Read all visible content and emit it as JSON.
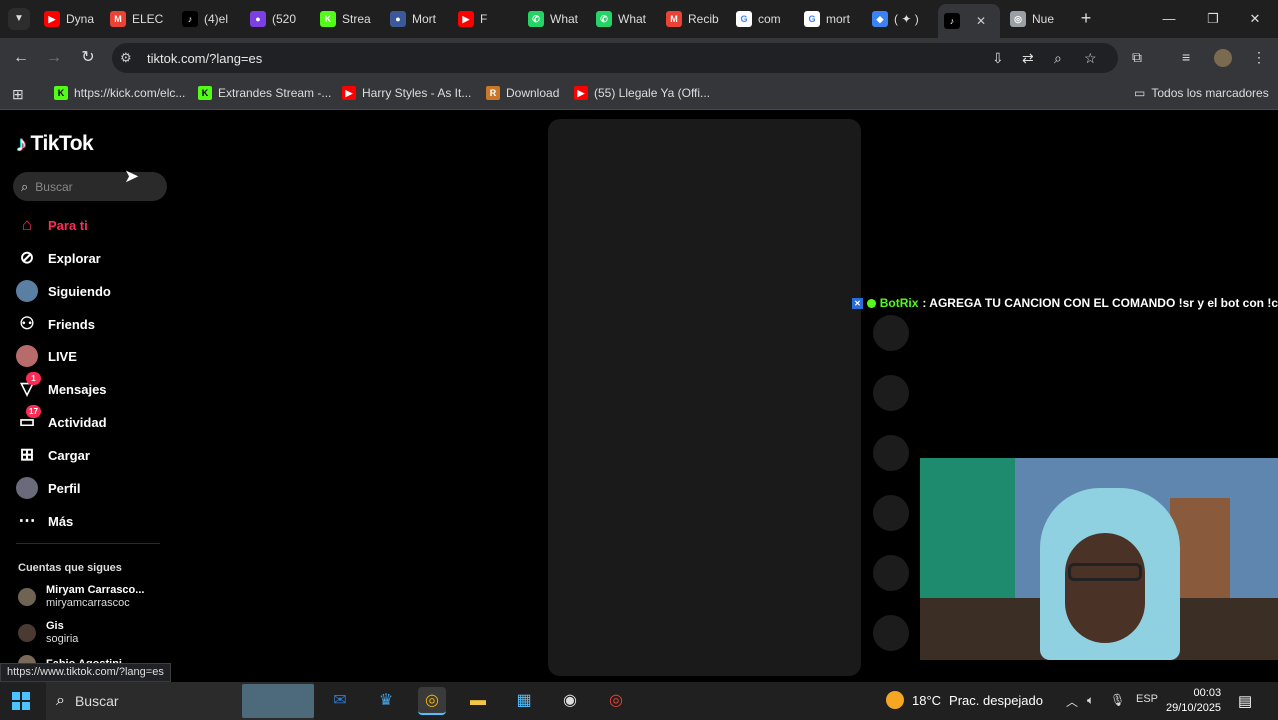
{
  "browser": {
    "tabs": [
      {
        "title": "Dyna",
        "icon": "youtube-icon",
        "color": "#ff0000",
        "glyph": "▶"
      },
      {
        "title": "ELEC",
        "icon": "gmail-icon",
        "color": "#ea4335",
        "glyph": "M"
      },
      {
        "title": "(4)el",
        "icon": "tiktok-icon",
        "color": "#000000",
        "glyph": "♪"
      },
      {
        "title": "(520",
        "icon": "app-icon",
        "color": "#7b3fe4",
        "glyph": "●"
      },
      {
        "title": "Strea",
        "icon": "kick-icon",
        "color": "#53fc18",
        "glyph": "K"
      },
      {
        "title": "Mort",
        "icon": "app-icon",
        "color": "#3b5998",
        "glyph": "●"
      },
      {
        "title": "F",
        "icon": "youtube-icon",
        "color": "#ff0000",
        "glyph": "▶"
      },
      {
        "title": "What",
        "icon": "whatsapp-icon",
        "color": "#25d366",
        "glyph": "✆"
      },
      {
        "title": "What",
        "icon": "whatsapp-icon",
        "color": "#25d366",
        "glyph": "✆"
      },
      {
        "title": "Recib",
        "icon": "gmail-icon",
        "color": "#ea4335",
        "glyph": "M"
      },
      {
        "title": "com",
        "icon": "google-icon",
        "color": "#ffffff",
        "glyph": "G"
      },
      {
        "title": "mort",
        "icon": "google-icon",
        "color": "#ffffff",
        "glyph": "G"
      },
      {
        "title": "( ✦ )",
        "icon": "app-icon",
        "color": "#3b82f6",
        "glyph": "◆"
      },
      {
        "title": "",
        "icon": "tiktok-icon",
        "color": "#000000",
        "glyph": "♪",
        "active": true
      },
      {
        "title": "Nue",
        "icon": "chrome-icon",
        "color": "#9aa0a6",
        "glyph": "◎"
      }
    ],
    "url": "tiktok.com/?lang=es",
    "bookmarks": [
      {
        "label": "https://kick.com/elc...",
        "color": "#53fc18",
        "glyph": "K"
      },
      {
        "label": "Extrandes Stream -...",
        "color": "#53fc18",
        "glyph": "K"
      },
      {
        "label": "Harry Styles - As It...",
        "color": "#ff0000",
        "glyph": "▶"
      },
      {
        "label": "Download",
        "color": "#c9782a",
        "glyph": "R"
      },
      {
        "label": "(55) Llegale Ya (Offi...",
        "color": "#ff0000",
        "glyph": "▶"
      }
    ],
    "all_bookmarks": "Todos los marcadores",
    "status_url": "https://www.tiktok.com/?lang=es"
  },
  "tiktok": {
    "logo": "TikTok",
    "search_placeholder": "Buscar",
    "nav": [
      {
        "label": "Para ti",
        "icon": "home-icon",
        "glyph": "⌂",
        "active": true
      },
      {
        "label": "Explorar",
        "icon": "compass-icon",
        "glyph": "⊘"
      },
      {
        "label": "Siguiendo",
        "icon": "avatar",
        "glyph": ""
      },
      {
        "label": "Friends",
        "icon": "friends-icon",
        "glyph": "⚇"
      },
      {
        "label": "LIVE",
        "icon": "live-avatar",
        "glyph": ""
      },
      {
        "label": "Mensajes",
        "icon": "messages-icon",
        "glyph": "▽",
        "badge": "1"
      },
      {
        "label": "Actividad",
        "icon": "activity-icon",
        "glyph": "▭",
        "badge": "17"
      },
      {
        "label": "Cargar",
        "icon": "upload-icon",
        "glyph": "⊞"
      },
      {
        "label": "Perfil",
        "icon": "profile-avatar",
        "glyph": ""
      },
      {
        "label": "Más",
        "icon": "more-icon",
        "glyph": "⋯"
      }
    ],
    "following_title": "Cuentas que sigues",
    "following": [
      {
        "name": "Miryam Carrasco...",
        "handle": "miryamcarrascoc"
      },
      {
        "name": "Gis",
        "handle": "sogiria"
      },
      {
        "name": "Fabio Agostini",
        "handle": ""
      }
    ]
  },
  "overlay": {
    "chat_user": "BotRix",
    "chat_message": ": AGREGA TU CANCION CON EL COMANDO !sr y el bot con !c"
  },
  "taskbar": {
    "search_label": "Buscar",
    "weather_temp": "18°C",
    "weather_desc": "Prac. despejado",
    "lang": "ESP",
    "time": "00:03",
    "date": "29/10/2025"
  }
}
